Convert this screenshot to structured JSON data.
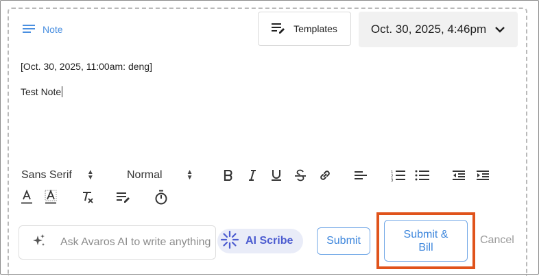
{
  "header": {
    "note_tab_label": "Note",
    "templates_label": "Templates",
    "datetime_label": "Oct. 30, 2025, 4:46pm"
  },
  "editor": {
    "line1": "[Oct. 30, 2025, 11:00am: deng]",
    "line2": "Test Note"
  },
  "toolbar": {
    "font_family": "Sans Serif",
    "font_size": "Normal"
  },
  "footer": {
    "ask_placeholder": "Ask Avaros AI to write anything",
    "ai_scribe_label": "AI Scribe",
    "submit_label": "Submit",
    "submit_bill_label": "Submit &\nBill",
    "cancel_label": "Cancel"
  },
  "colors": {
    "accent_blue": "#3d86dc",
    "highlight": "#e0531b",
    "scribe_bg": "#e9ecf8",
    "scribe_text": "#4b5bd0"
  }
}
